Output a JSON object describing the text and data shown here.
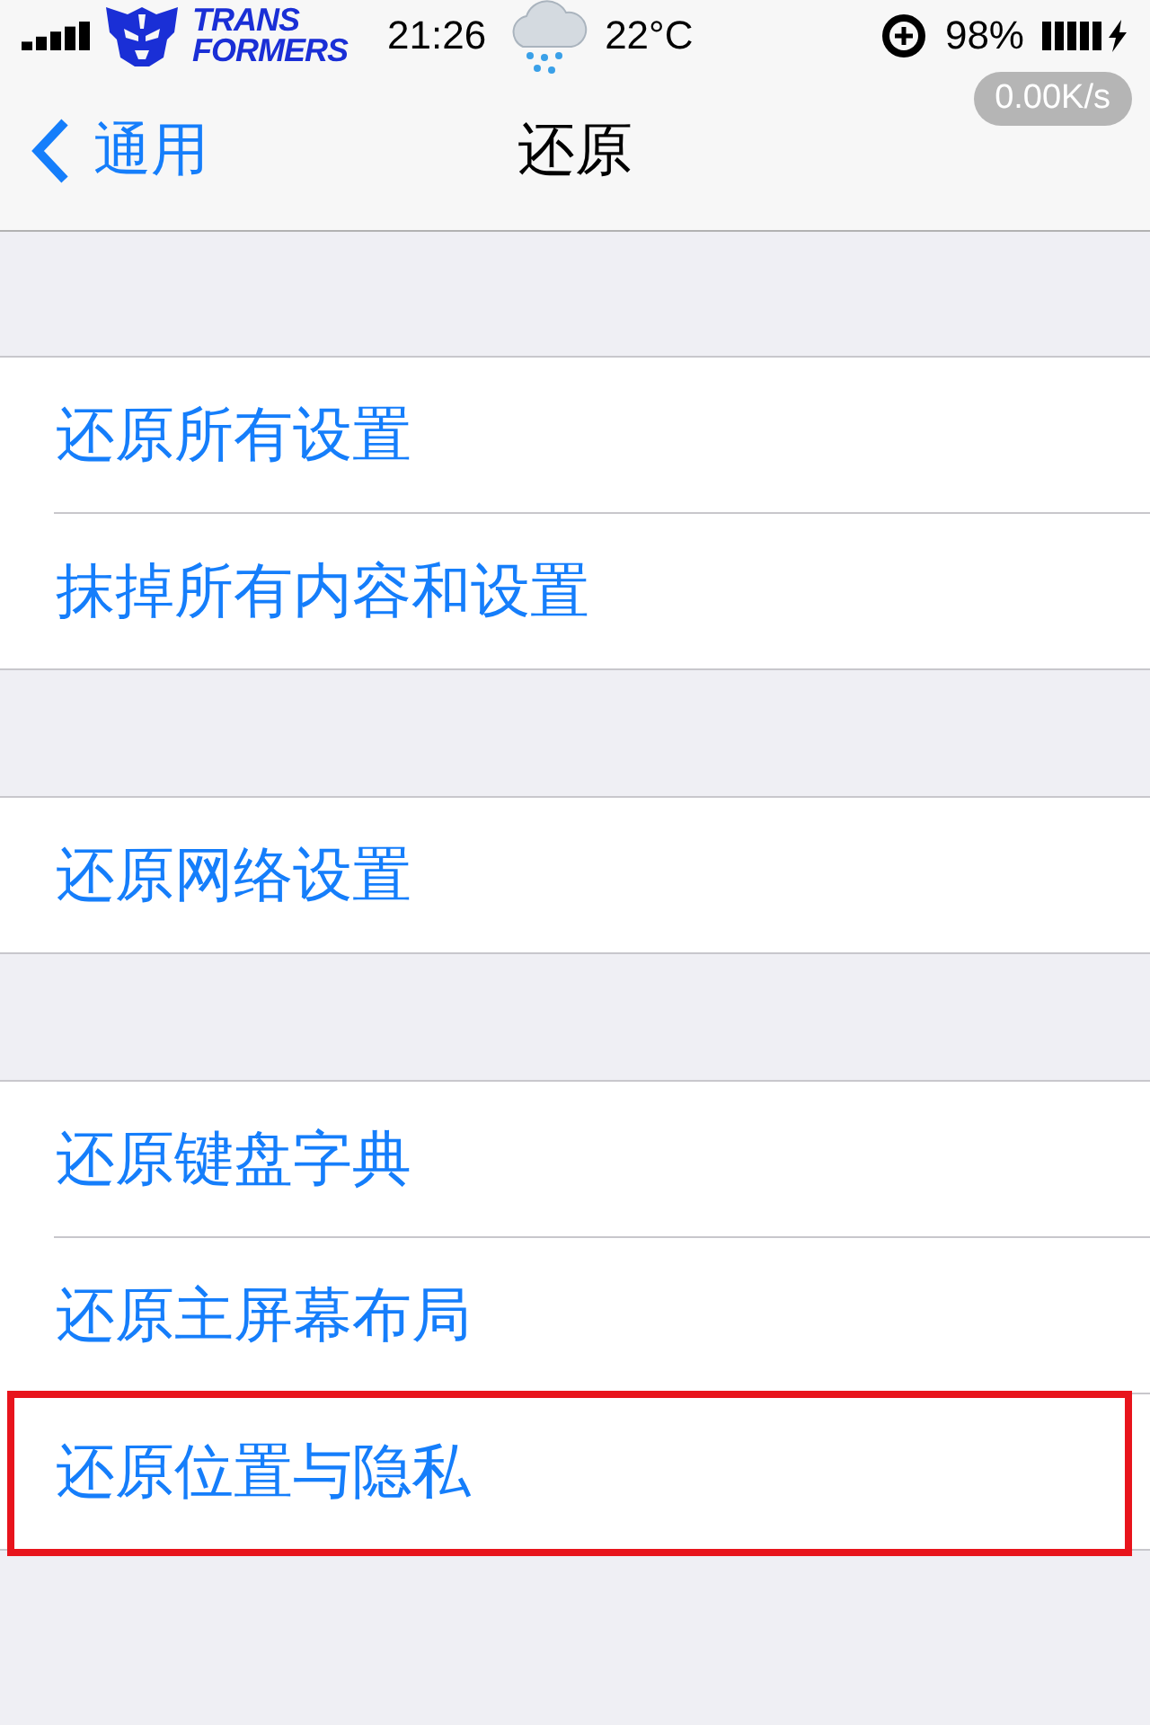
{
  "status_bar": {
    "logo": [
      "TRANS",
      "FORMERS"
    ],
    "time": "21:26",
    "temperature": "22°C",
    "battery": "98%",
    "speed": "0.00K/s"
  },
  "nav_bar": {
    "back": "通用",
    "title": "还原"
  },
  "groups": [
    {
      "items": [
        {
          "label": "还原所有设置",
          "highlighted": false
        },
        {
          "label": "抹掉所有内容和设置",
          "highlighted": false
        }
      ]
    },
    {
      "items": [
        {
          "label": "还原网络设置",
          "highlighted": false
        }
      ]
    },
    {
      "items": [
        {
          "label": "还原键盘字典",
          "highlighted": false
        },
        {
          "label": "还原主屏幕布局",
          "highlighted": false
        },
        {
          "label": "还原位置与隐私",
          "highlighted": true
        }
      ]
    }
  ]
}
